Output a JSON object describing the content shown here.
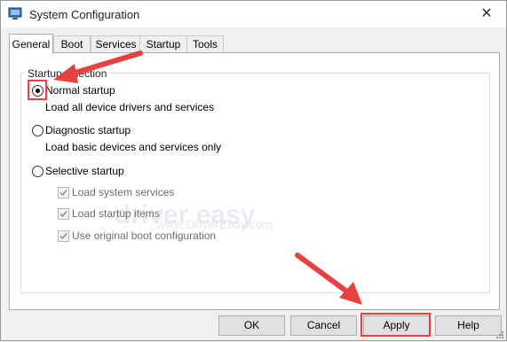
{
  "window": {
    "title": "System Configuration",
    "icon": "system-config-icon",
    "close_glyph": "✕"
  },
  "tabs": [
    {
      "label": "General",
      "active": true
    },
    {
      "label": "Boot",
      "active": false
    },
    {
      "label": "Services",
      "active": false
    },
    {
      "label": "Startup",
      "active": false
    },
    {
      "label": "Tools",
      "active": false
    }
  ],
  "startup_selection": {
    "legend": "Startup selection",
    "options": [
      {
        "label": "Normal startup",
        "description": "Load all device drivers and services",
        "selected": true
      },
      {
        "label": "Diagnostic startup",
        "description": "Load basic devices and services only",
        "selected": false
      },
      {
        "label": "Selective startup",
        "selected": false,
        "items": [
          {
            "label": "Load system services",
            "checked": true,
            "enabled": false
          },
          {
            "label": "Load startup items",
            "checked": true,
            "enabled": false
          },
          {
            "label": "Use original boot configuration",
            "checked": true,
            "enabled": false
          }
        ]
      }
    ]
  },
  "watermark": {
    "brand": "driver easy",
    "url": "www.DriverEasy.com"
  },
  "buttons": {
    "ok": "OK",
    "cancel": "Cancel",
    "apply": "Apply",
    "help": "Help"
  },
  "annotation_color": "#e8413f"
}
